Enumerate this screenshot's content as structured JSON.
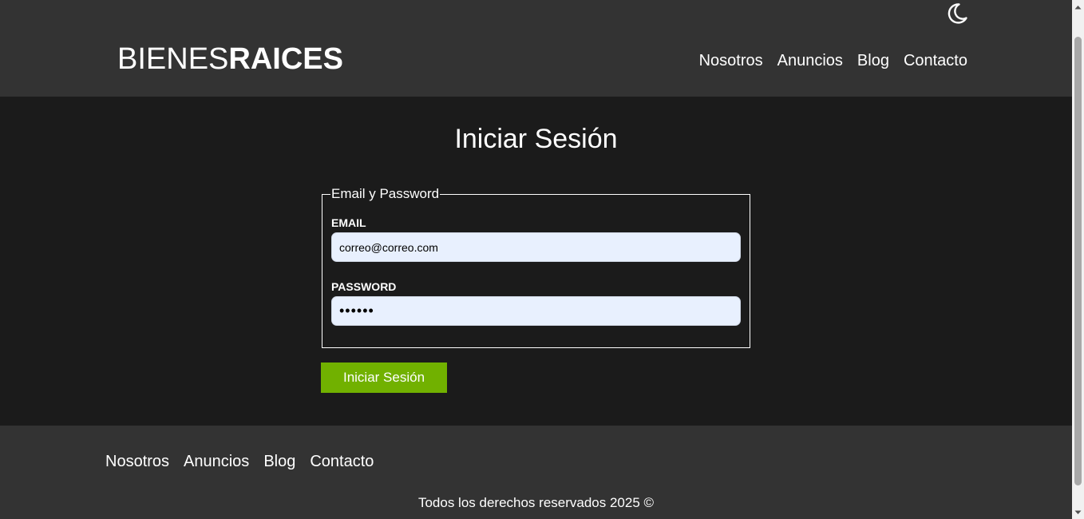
{
  "header": {
    "logo_light": "BIENES",
    "logo_bold": "RAICES",
    "dark_mode_icon": "moon-icon",
    "nav": [
      {
        "label": "Nosotros"
      },
      {
        "label": "Anuncios"
      },
      {
        "label": "Blog"
      },
      {
        "label": "Contacto"
      }
    ]
  },
  "main": {
    "title": "Iniciar Sesión",
    "fieldset_legend": "Email y Password",
    "email": {
      "label": "EMAIL",
      "value": "correo@correo.com"
    },
    "password": {
      "label": "PASSWORD",
      "value": "••••••"
    },
    "submit_label": "Iniciar Sesión"
  },
  "footer": {
    "nav": [
      {
        "label": "Nosotros"
      },
      {
        "label": "Anuncios"
      },
      {
        "label": "Blog"
      },
      {
        "label": "Contacto"
      }
    ],
    "copyright": "Todos los derechos reservados 2025 ©"
  },
  "colors": {
    "header_bg": "#333333",
    "body_bg": "#1b1b1b",
    "accent_green": "#71b100",
    "input_bg": "#e8f0fe"
  }
}
